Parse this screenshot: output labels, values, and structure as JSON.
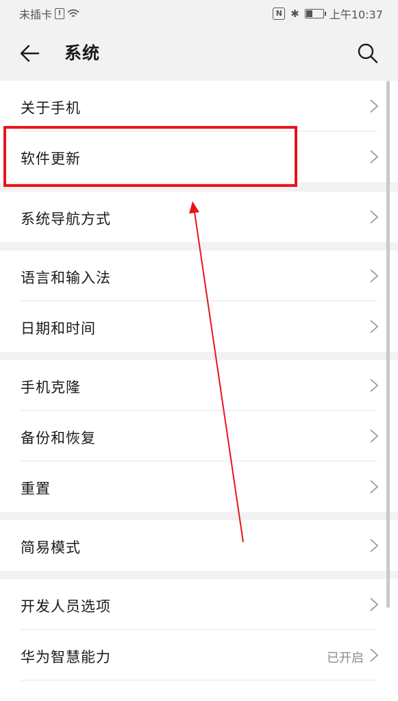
{
  "status_bar": {
    "carrier": "未插卡",
    "sim_glyph": "!",
    "nfc_glyph": "N",
    "bt_glyph": "✱",
    "time": "上午10:37"
  },
  "header": {
    "title": "系统"
  },
  "groups": [
    {
      "items": [
        {
          "label": "关于手机"
        },
        {
          "label": "软件更新"
        }
      ]
    },
    {
      "items": [
        {
          "label": "系统导航方式"
        }
      ]
    },
    {
      "items": [
        {
          "label": "语言和输入法"
        },
        {
          "label": "日期和时间"
        }
      ]
    },
    {
      "items": [
        {
          "label": "手机克隆"
        },
        {
          "label": "备份和恢复"
        },
        {
          "label": "重置"
        }
      ]
    },
    {
      "items": [
        {
          "label": "简易模式"
        }
      ]
    },
    {
      "items": [
        {
          "label": "开发人员选项"
        },
        {
          "label": "华为智慧能力",
          "value": "已开启"
        }
      ]
    }
  ],
  "annotation": {
    "highlight_color": "#e8141c",
    "arrow_color": "#e8141c"
  }
}
